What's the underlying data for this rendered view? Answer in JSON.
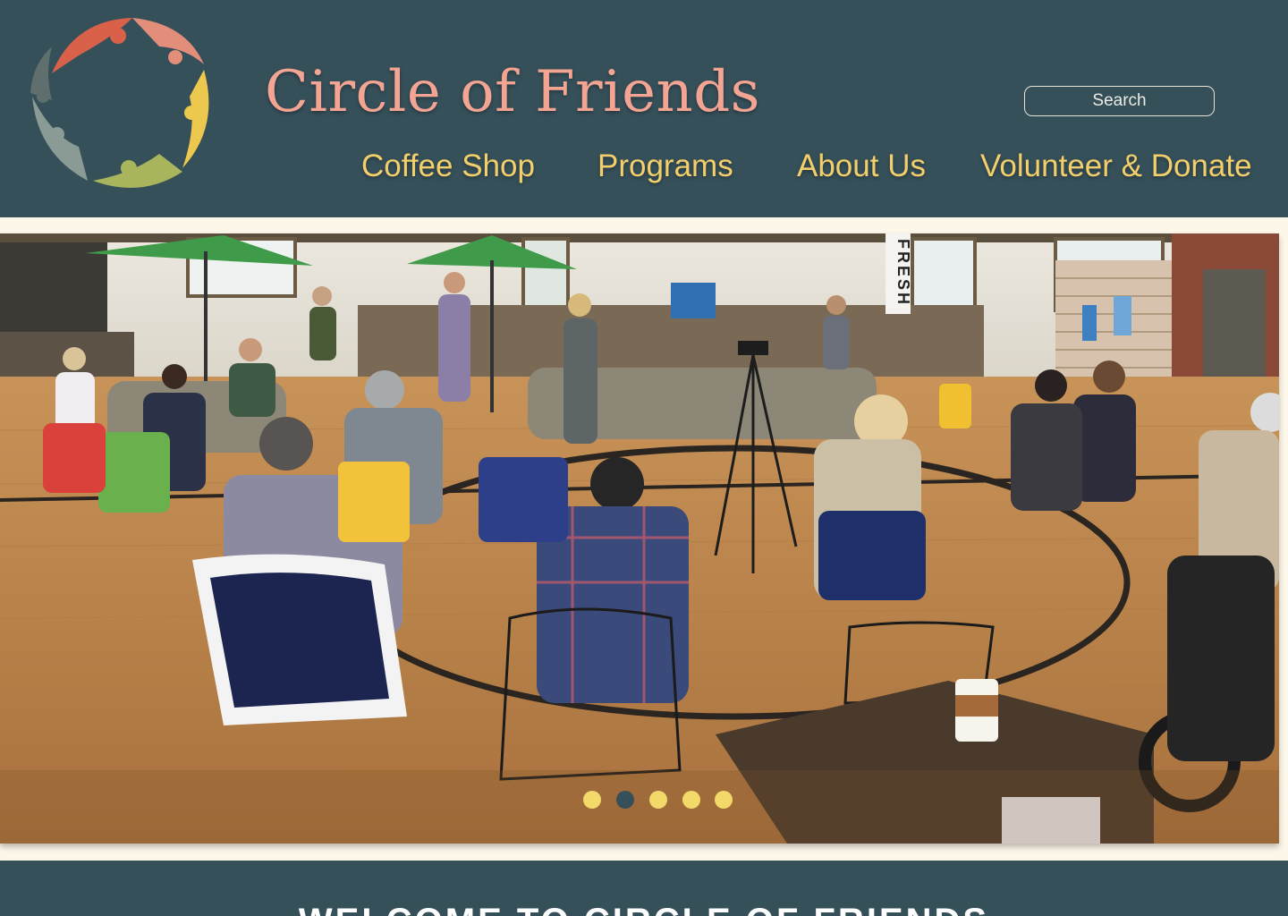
{
  "header": {
    "site_title": "Circle of Friends",
    "search_placeholder": "Search",
    "logo_icon": "circle-of-friends-logo-icon"
  },
  "nav": {
    "items": [
      {
        "label": "Coffee Shop"
      },
      {
        "label": "Programs"
      },
      {
        "label": "About Us"
      },
      {
        "label": "Volunteer & Donate"
      }
    ]
  },
  "hero": {
    "image_subject": "community-room-photo",
    "wall_sign": "FRESH",
    "carousel": {
      "slide_count": 5,
      "active_index": 1
    }
  },
  "welcome": {
    "title": "WELCOME TO CIRCLE OF FRIENDS"
  },
  "colors": {
    "header_bg": "#36505a",
    "title": "#f4a493",
    "nav": "#f3cf6b",
    "page_bg": "#fdf7ea",
    "dot": "#f3d86a",
    "dot_active": "#36505a"
  }
}
